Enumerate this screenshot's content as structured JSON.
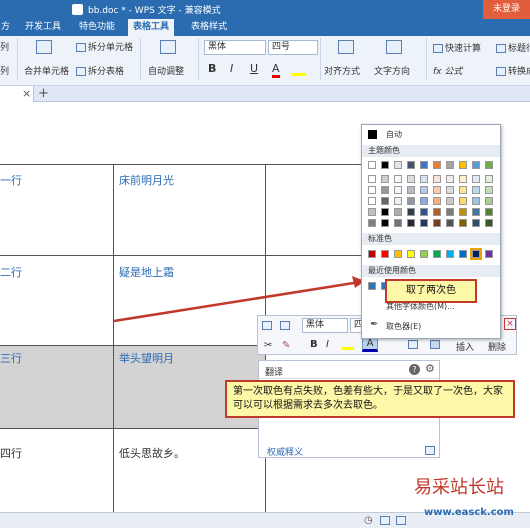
{
  "window": {
    "title": "bb.doc * - WPS 文字 - 兼容模式",
    "login": "未登录"
  },
  "tabs": [
    {
      "label": "方"
    },
    {
      "label": "开发工具"
    },
    {
      "label": "特色功能"
    },
    {
      "label": "表格工具"
    },
    {
      "label": "表格样式"
    }
  ],
  "ribbon": {
    "left_col_1": "列",
    "left_col_2": "列",
    "merge_cells": "合并单元格",
    "split_cells": "拆分单元格",
    "split_table": "拆分表格",
    "auto_adjust": "自动调整",
    "font_name": "黑体",
    "font_size": "四号",
    "bold": "B",
    "italic": "I",
    "underline": "U",
    "font_color_letter": "A",
    "align": "对齐方式",
    "text_direction": "文字方向",
    "formula": "fx 公式",
    "quick_calc": "快速计算",
    "title_row": "标题行",
    "convert_text": "转换成"
  },
  "doc_tab_close": "×",
  "doc_tab_add": "+",
  "table": {
    "rows": [
      {
        "left": "一行",
        "right": "床前明月光"
      },
      {
        "left": "二行",
        "right": "疑是地上霜"
      },
      {
        "left": "三行",
        "right": "举头望明月"
      },
      {
        "left": "四行",
        "right": "低头思故乡。"
      }
    ]
  },
  "color_popup": {
    "auto": "自动",
    "theme_colors": "主题颜色",
    "standard_colors": "标准色",
    "recent_colors": "最近使用颜色",
    "more_colors": "其他字体颜色(M)...",
    "picker": "取色器(E)",
    "theme_top": [
      "#ffffff",
      "#000000",
      "#e7e6e6",
      "#44546a",
      "#4472c4",
      "#ed7d31",
      "#a5a5a5",
      "#ffc000",
      "#5b9bd5",
      "#70ad47"
    ],
    "standard": [
      "#c00000",
      "#ff0000",
      "#ffc000",
      "#ffff00",
      "#92d050",
      "#00b050",
      "#00b0f0",
      "#0070c0",
      "#002060",
      "#7030a0"
    ],
    "recent": [
      "#2e75b6",
      "#2e75b6"
    ]
  },
  "callout_small": "取了两次色",
  "callout_big": "第一次取色有点失败，色差有些大，于是又取了一次色，大家可以可以根据需求去多次去取色。",
  "mini_toolbar": {
    "font": "黑体",
    "size": "四",
    "bold": "B",
    "italic": "I",
    "font_color": "A",
    "insert": "插入",
    "delete": "删除"
  },
  "translate": {
    "title": "翻译",
    "link": "权威释义"
  },
  "watermark": {
    "top": "易采站长站",
    "bottom": "www.easck.com"
  }
}
